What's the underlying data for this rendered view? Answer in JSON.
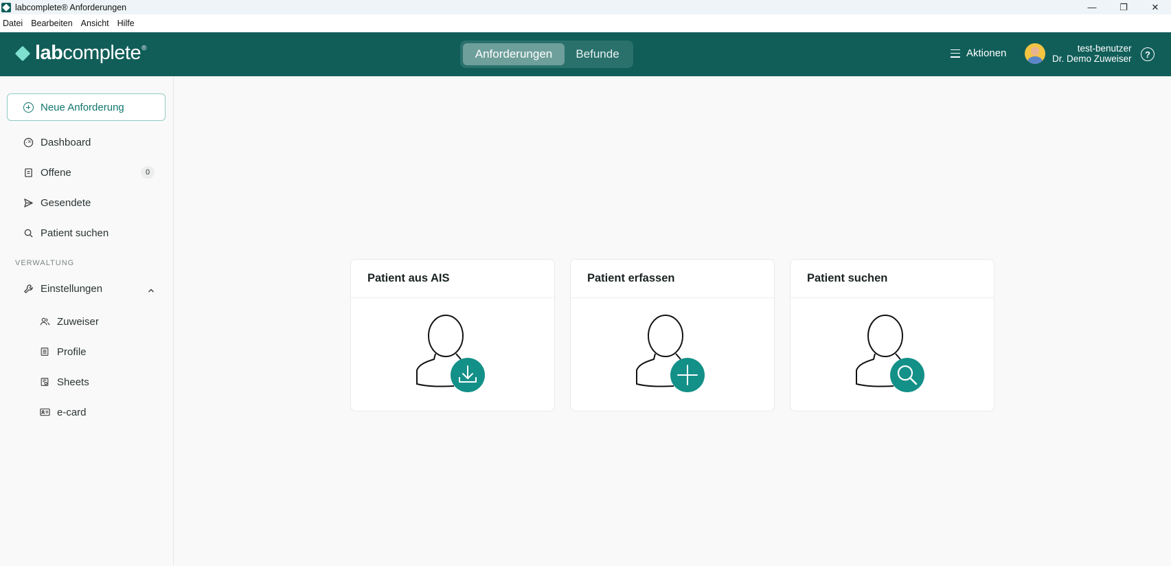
{
  "window": {
    "title": "labcomplete® Anforderungen",
    "controls": [
      "—",
      "❐",
      "✕"
    ]
  },
  "menubar": {
    "items": [
      "Datei",
      "Bearbeiten",
      "Ansicht",
      "Hilfe"
    ]
  },
  "header": {
    "logo_bold": "lab",
    "logo_regular": "complete",
    "logo_reg": "®",
    "tabs": [
      {
        "label": "Anforderungen",
        "active": true
      },
      {
        "label": "Befunde",
        "active": false
      }
    ],
    "actions_label": "Aktionen",
    "user_name": "test-benutzer",
    "user_role": "Dr. Demo Zuweiser",
    "help_label": "?",
    "accent_color": "#115e59"
  },
  "sidebar": {
    "new_request_label": "Neue Anforderung",
    "items": [
      {
        "label": "Dashboard",
        "icon": "gauge-icon"
      },
      {
        "label": "Offene",
        "icon": "clipboard-icon",
        "badge": "0"
      },
      {
        "label": "Gesendete",
        "icon": "send-icon"
      },
      {
        "label": "Patient suchen",
        "icon": "search-icon"
      }
    ],
    "section_label": "VERWALTUNG",
    "settings_label": "Einstellungen",
    "sub_items": [
      {
        "label": "Zuweiser",
        "icon": "users-icon"
      },
      {
        "label": "Profile",
        "icon": "list-icon"
      },
      {
        "label": "Sheets",
        "icon": "sheet-icon"
      },
      {
        "label": "e-card",
        "icon": "id-card-icon"
      }
    ]
  },
  "main": {
    "cards": [
      {
        "title": "Patient aus AIS",
        "icon": "patient-download-icon"
      },
      {
        "title": "Patient erfassen",
        "icon": "patient-add-icon"
      },
      {
        "title": "Patient suchen",
        "icon": "patient-search-icon"
      }
    ]
  }
}
